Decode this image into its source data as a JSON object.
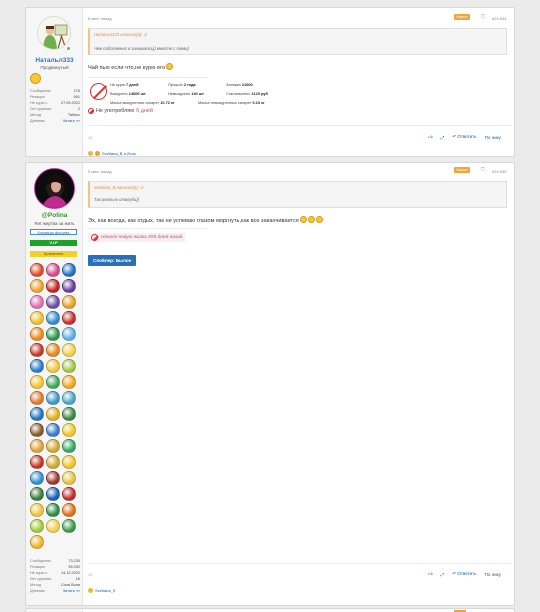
{
  "post1": {
    "author": "Натальл333",
    "user_title": "Продвинутый",
    "stats": [
      {
        "label": "Сообщения",
        "value": "276"
      },
      {
        "label": "Реакции",
        "value": "691"
      },
      {
        "label": "Не курю с",
        "value": "27.09.2022"
      },
      {
        "label": "Лет курения",
        "value": "2"
      },
      {
        "label": "Метод",
        "value": "Табекс"
      },
      {
        "label": "Дневник",
        "value": "Читать »»"
      }
    ],
    "time": "5 мин. назад",
    "new_badge": "Новое",
    "post_number": "#24.944",
    "quote_author": "Натальл333 написал(а):",
    "quote_text": "Чем собственно я занимаюсь)) вместе с теми)",
    "message": "Чай пью если что,не курю его",
    "sig_rows": [
      [
        {
          "label": "Не курю",
          "value": "7 дней"
        },
        {
          "label": "Прошло",
          "value": "2 года"
        },
        {
          "label": "Затяжек",
          "value": "21600"
        }
      ],
      [
        {
          "label": "Выкурено",
          "value": "14600 шт"
        },
        {
          "label": "Невыкурено",
          "value": "140 шт"
        },
        {
          "label": "Сэкономлено",
          "value": "1120 руб"
        }
      ],
      [
        {
          "label": "Масса выкуренных сигарет",
          "value": "10.72 кг"
        },
        {
          "label": "Масса невыкуренных сигарет",
          "value": "0.10 кг"
        }
      ]
    ],
    "no_smoke_prefix": "Не употребляю",
    "no_smoke_days": "6 дней",
    "mini_count": "19",
    "reply": "Ответить",
    "quote_btn": "По нику",
    "likes_text": "Svetlana_B и Zeus"
  },
  "post2": {
    "author": "@Polina",
    "user_title": "Ret жертва за жить",
    "badge_team": "Команда форума",
    "badge_vip": "V.I.P",
    "badge_keeper": "Хранитель",
    "stats": [
      {
        "label": "Сообщения",
        "value": "73.230"
      },
      {
        "label": "Реакции",
        "value": "95.092"
      },
      {
        "label": "Не курю с",
        "value": "14.12.2020"
      },
      {
        "label": "Лет курения",
        "value": "16"
      },
      {
        "label": "Метод",
        "value": "Сила Воли"
      },
      {
        "label": "Дневник",
        "value": "Читать »»"
      }
    ],
    "time": "5 мин. назад",
    "new_badge": "Новое",
    "post_number": "#24.945",
    "quote_author": "Svetlana_B написал(а):",
    "quote_text": "Так реально отвлуби))",
    "message": "Эх, как всегда, как отдых, так не успеваю глазом моргнуть,как все заканчивается",
    "life_text": "Начало новую жизнь 659 дней назад",
    "spoiler": "Спойлер: Былое",
    "mini_count": "19",
    "reply": "Ответить",
    "quote_btn": "По нику",
    "likes_text": "Svetlana_S"
  },
  "achievement_colors": [
    "#e34b2c",
    "#d94a8a",
    "#1f73c6",
    "#f0a32a",
    "#c22",
    "#6a3da0",
    "#e06fb0",
    "#6d4fa3",
    "#e8a220",
    "#f4be2a",
    "#2e8bd6",
    "#c8302a",
    "#f28a1c",
    "#2b9a4a",
    "#5ab0e6",
    "#c83a28",
    "#e88a16",
    "#f3d04a",
    "#2c7bcc",
    "#f3c63a",
    "#a5c842",
    "#f6c230",
    "#3eaa58",
    "#f0a818",
    "#e07b2a",
    "#3c9acc",
    "#4ca8c8",
    "#1f77c0",
    "#e2b11c",
    "#3a8a3e",
    "#8a5c2a",
    "#3b7bd1",
    "#f4c624",
    "#e4a038",
    "#d4a82a",
    "#38a866",
    "#cc3426",
    "#d2a82c",
    "#f5c21e",
    "#2f8fd4",
    "#a03a2a",
    "#e8c440",
    "#3a7f3e",
    "#1a62b5",
    "#c42c2c",
    "#f2c33a",
    "#2a8f46",
    "#e2701a",
    "#9fcf3a",
    "#f4d04a",
    "#3e9b4c",
    "#f2b52a"
  ]
}
